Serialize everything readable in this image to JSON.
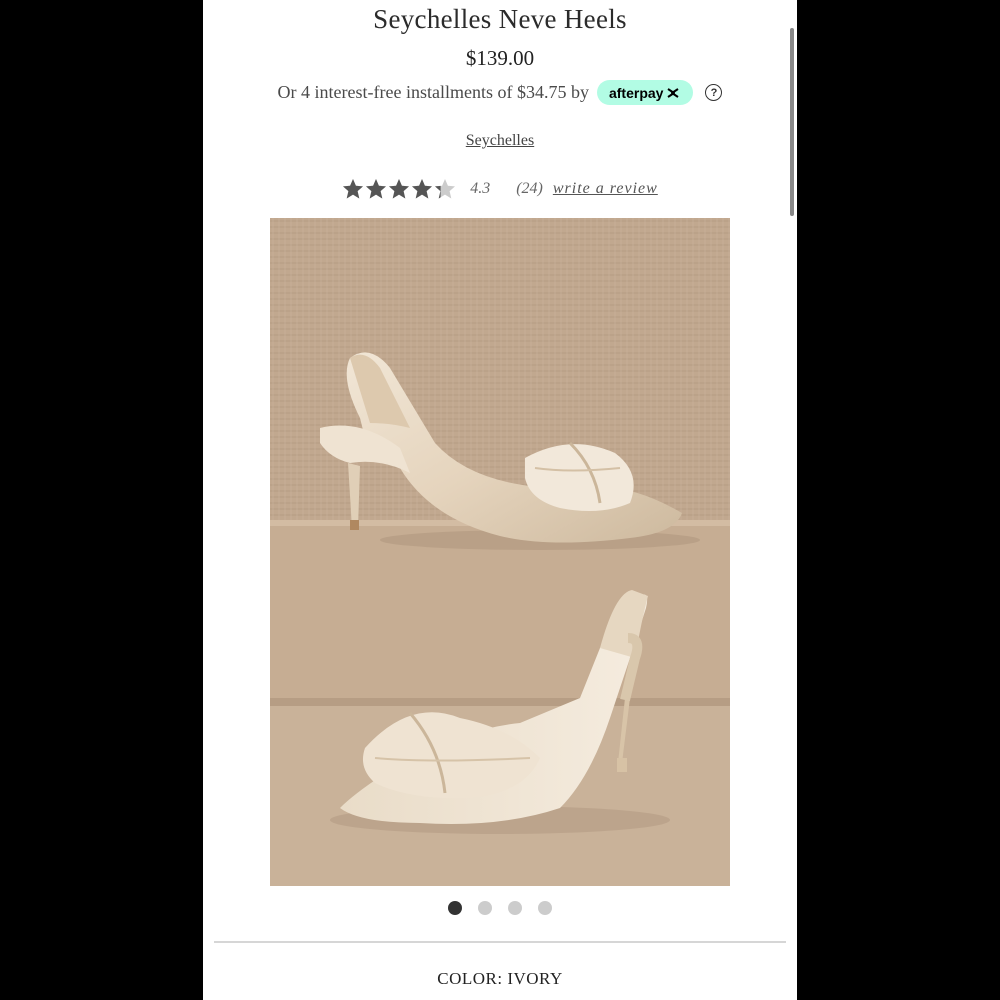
{
  "product": {
    "title": "Seychelles Neve Heels",
    "price": "$139.00",
    "installments_text": "Or 4 interest-free installments of $34.75 by",
    "afterpay_label": "afterpay",
    "help_label": "?",
    "brand": "Seychelles"
  },
  "rating": {
    "value": "4.3",
    "stars_filled": 4.3,
    "count": "(24)",
    "write_review": "write a review"
  },
  "gallery": {
    "image_count": 4,
    "active_index": 0
  },
  "options": {
    "color_label": "COLOR: IVORY"
  },
  "colors": {
    "afterpay_bg": "#b2fce4",
    "star_filled": "#555555",
    "star_empty": "#cccccc"
  }
}
